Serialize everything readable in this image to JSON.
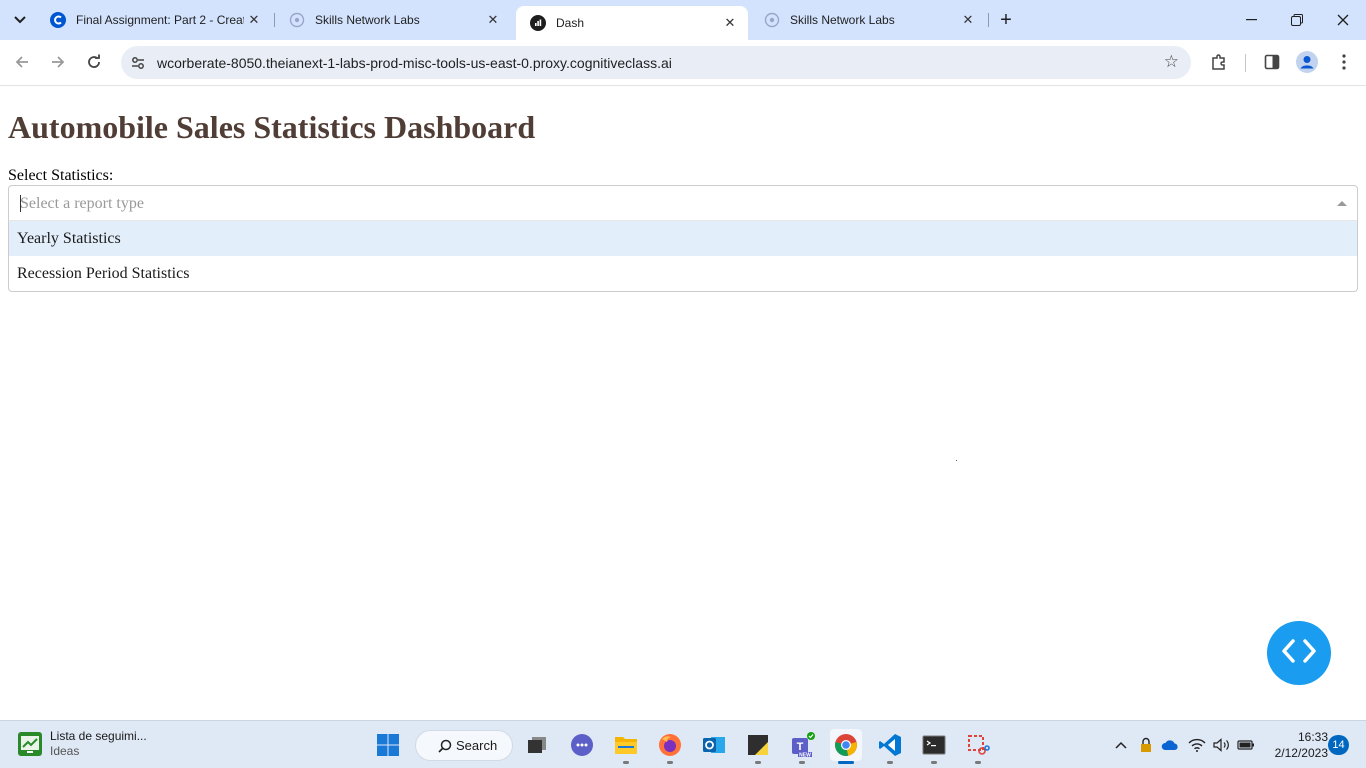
{
  "browser": {
    "tabs": [
      {
        "title": "Final Assignment: Part 2 - Creat",
        "favicon": "coursera-icon",
        "active": false
      },
      {
        "title": "Skills Network Labs",
        "favicon": "skills-network-icon",
        "active": false
      },
      {
        "title": "Dash",
        "favicon": "dash-icon",
        "active": true
      },
      {
        "title": "Skills Network Labs",
        "favicon": "skills-network-icon",
        "active": false
      }
    ],
    "url": "wcorberate-8050.theianext-1-labs-prod-misc-tools-us-east-0.proxy.cognitiveclass.ai",
    "colors": {
      "tabstrip": "#d3e3fd",
      "omnibox": "#e9eef6"
    }
  },
  "page": {
    "title": "Automobile Sales Statistics Dashboard",
    "title_color": "#503D36",
    "select_label": "Select Statistics:",
    "dropdown": {
      "placeholder": "Select a report type",
      "open": true,
      "options": [
        "Yearly Statistics",
        "Recession Period Statistics"
      ],
      "highlighted_index": 0
    },
    "fab_icon": "code-brackets-icon",
    "fab_color": "#1a9cf0"
  },
  "taskbar": {
    "widget": {
      "line1": "Lista de seguimi...",
      "line2": "Ideas"
    },
    "search_label": "Search",
    "pinned": [
      "windows-start-icon",
      "task-view-icon",
      "chat-icon",
      "file-explorer-icon",
      "firefox-icon",
      "outlook-icon",
      "sticky-notes-icon",
      "teams-icon",
      "chrome-icon",
      "vscode-icon",
      "terminal-icon",
      "snipping-tool-icon"
    ],
    "active_app": "chrome-icon",
    "tray": [
      "chevron-up-icon",
      "security-icon",
      "onedrive-icon",
      "wifi-icon",
      "volume-icon",
      "battery-icon"
    ],
    "time": "16:33",
    "date": "2/12/2023",
    "notification_count": "14"
  }
}
